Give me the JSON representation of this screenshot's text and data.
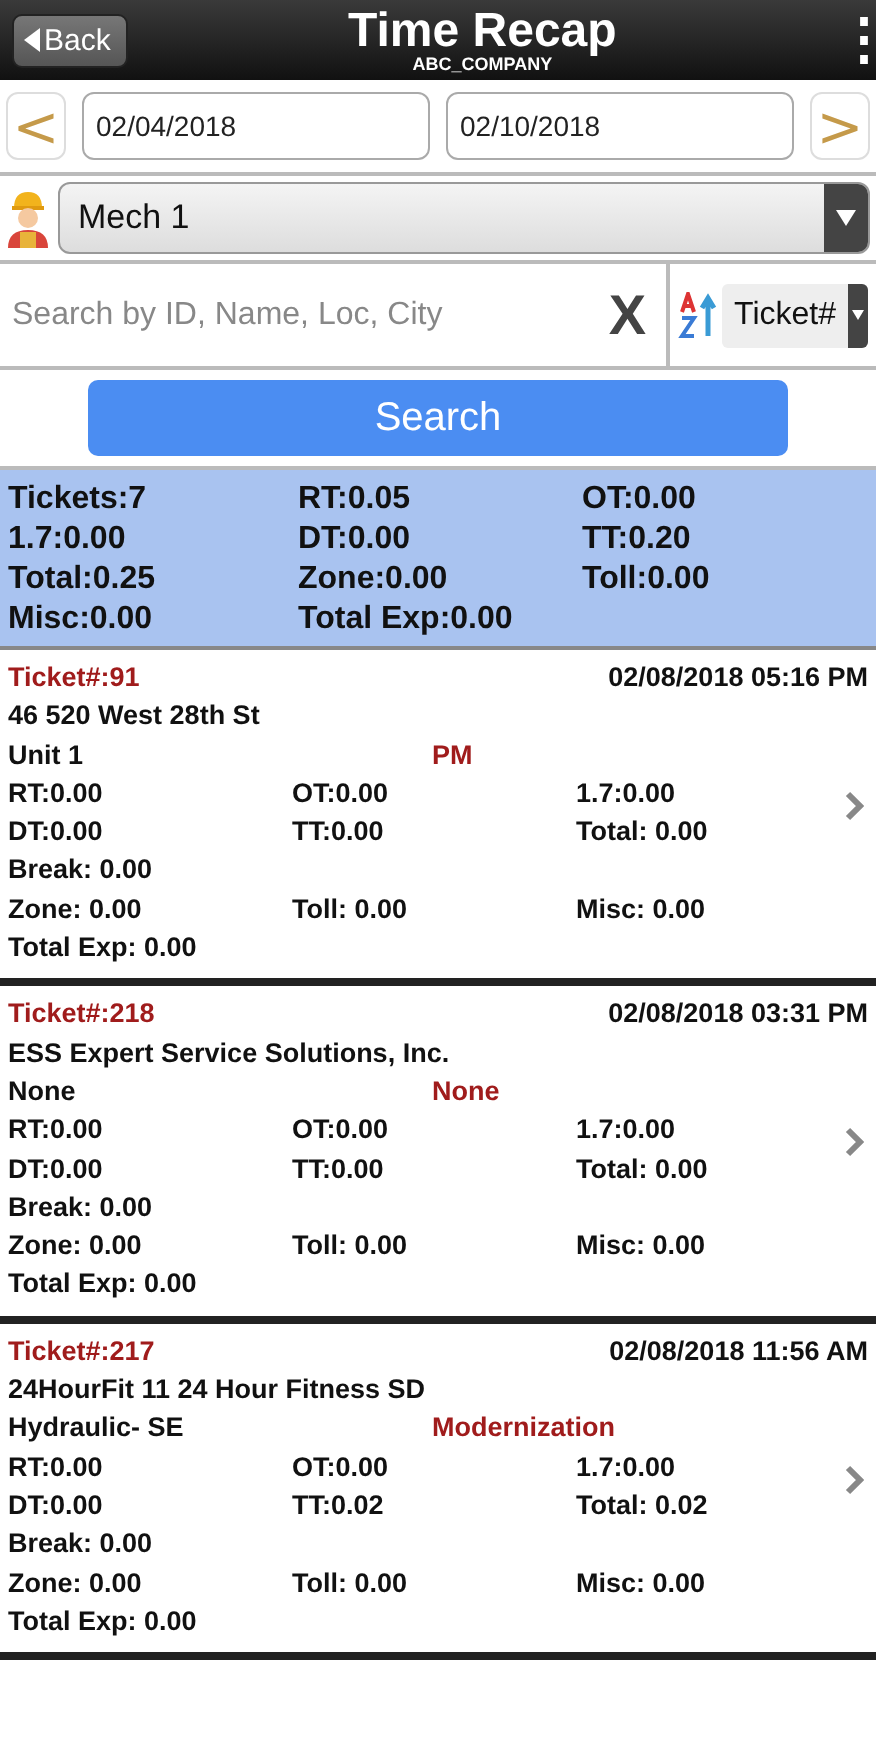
{
  "header": {
    "back": "Back",
    "title": "Time Recap",
    "subtitle": "ABC_COMPANY",
    "menu": "⋮"
  },
  "date_range": {
    "prev": "<",
    "start": "02/04/2018",
    "end": "02/10/2018",
    "next": ">"
  },
  "mechanic": {
    "value": "Mech 1"
  },
  "search": {
    "placeholder": "Search by ID, Name, Loc, City",
    "clear": "X",
    "sort_by": "Ticket#",
    "button": "Search"
  },
  "summary": [
    [
      "Tickets:7",
      "RT:0.05",
      "OT:0.00"
    ],
    [
      "1.7:0.00",
      "DT:0.00",
      "TT:0.20"
    ],
    [
      "Total:0.25",
      "Zone:0.00",
      "Toll:0.00"
    ],
    [
      "Misc:0.00",
      "Total Exp:0.00"
    ]
  ],
  "tickets": [
    {
      "ticket": "Ticket#:91",
      "datetime": "02/08/2018 05:16 PM",
      "customer": "46 520 West 28th St",
      "unit": "Unit 1",
      "type": "PM",
      "rows": [
        [
          "RT:0.00",
          "OT:0.00",
          "1.7:0.00"
        ],
        [
          "DT:0.00",
          "TT:0.00",
          "Total: 0.00"
        ],
        [
          "Break: 0.00"
        ],
        [
          "Zone: 0.00",
          "Toll: 0.00",
          "Misc: 0.00"
        ],
        [
          "Total Exp: 0.00"
        ]
      ]
    },
    {
      "ticket": "Ticket#:218",
      "datetime": "02/08/2018 03:31 PM",
      "customer": "ESS Expert Service Solutions, Inc.",
      "unit": "None",
      "type": "None",
      "rows": [
        [
          "RT:0.00",
          "OT:0.00",
          "1.7:0.00"
        ],
        [
          "DT:0.00",
          "TT:0.00",
          "Total: 0.00"
        ],
        [
          "Break: 0.00"
        ],
        [
          "Zone: 0.00",
          "Toll: 0.00",
          "Misc: 0.00"
        ],
        [
          "Total Exp: 0.00"
        ]
      ]
    },
    {
      "ticket": "Ticket#:217",
      "datetime": "02/08/2018 11:56 AM",
      "customer": "24HourFit 11 24 Hour Fitness SD",
      "unit": "Hydraulic- SE",
      "type": "Modernization",
      "rows": [
        [
          "RT:0.00",
          "OT:0.00",
          "1.7:0.00"
        ],
        [
          "DT:0.00",
          "TT:0.02",
          "Total: 0.02"
        ],
        [
          "Break: 0.00"
        ],
        [
          "Zone: 0.00",
          "Toll: 0.00",
          "Misc: 0.00"
        ],
        [
          "Total Exp: 0.00"
        ]
      ]
    }
  ]
}
